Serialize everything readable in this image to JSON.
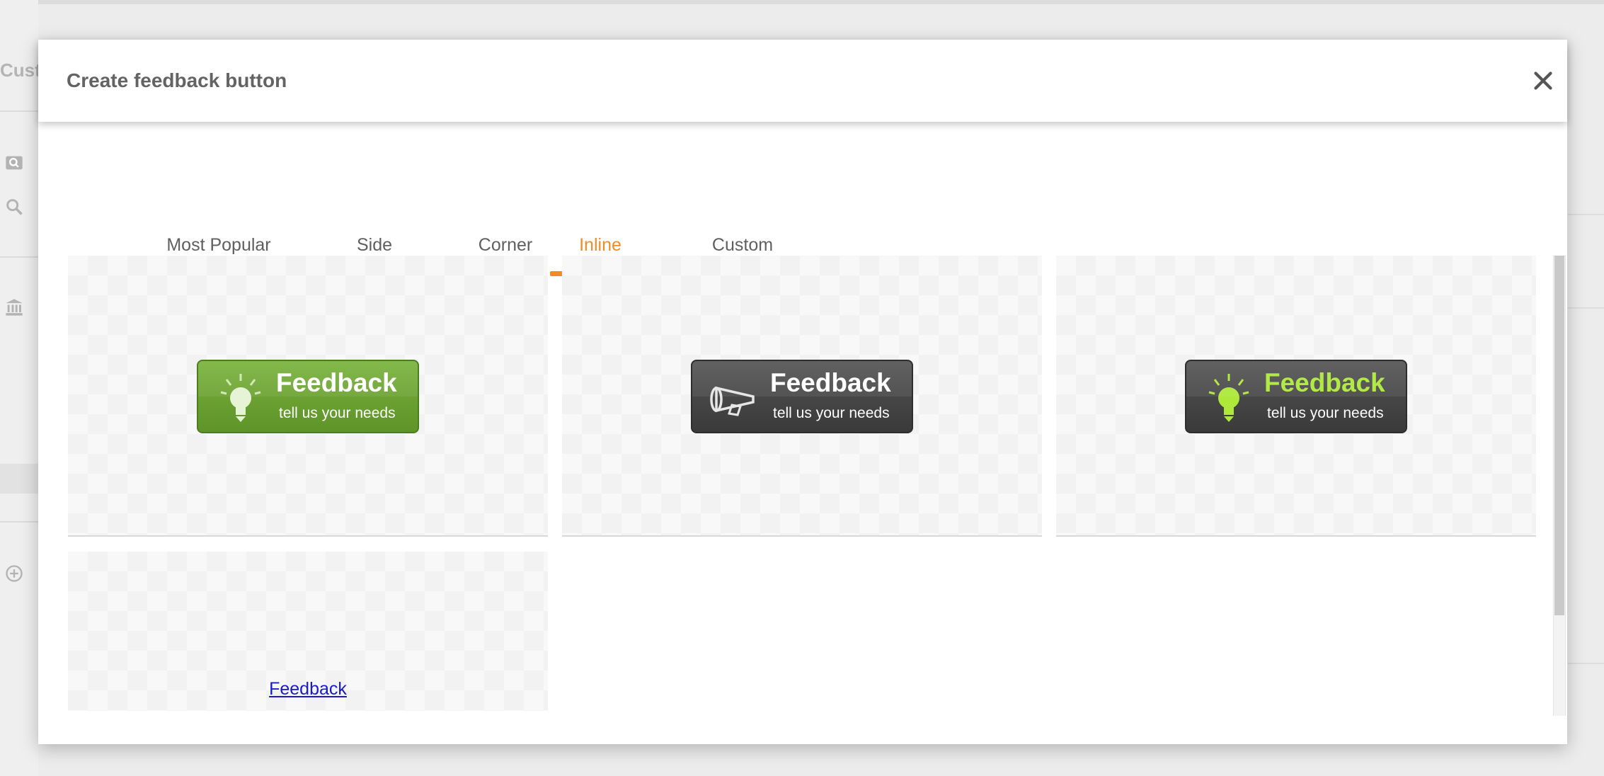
{
  "background_app": {
    "partial_title": "Custo",
    "sidebar_icons": [
      "image-search-icon",
      "search-icon",
      "bank-icon",
      "add-circle-icon"
    ]
  },
  "modal": {
    "title": "Create feedback button",
    "close_icon": "close-icon"
  },
  "tabs": [
    {
      "label": "Most Popular",
      "active": false
    },
    {
      "label": "Side",
      "active": false
    },
    {
      "label": "Corner",
      "active": false
    },
    {
      "label": "Inline",
      "active": true
    },
    {
      "label": "Custom",
      "active": false
    }
  ],
  "buttons": [
    {
      "style": "green",
      "icon": "lightbulb-icon",
      "title": "Feedback",
      "subtitle": "tell us your needs"
    },
    {
      "style": "dark",
      "icon": "megaphone-icon",
      "title": "Feedback",
      "subtitle": "tell us your needs"
    },
    {
      "style": "dark-lime",
      "icon": "lightbulb-icon",
      "title": "Feedback",
      "subtitle": "tell us your needs"
    },
    {
      "style": "text-link",
      "title": "Feedback"
    }
  ],
  "colors": {
    "accent": "#ef8c28",
    "green_button": "#6ba232",
    "dark_button": "#474747",
    "lime_text": "#aee83a",
    "link": "#1a1acc"
  }
}
